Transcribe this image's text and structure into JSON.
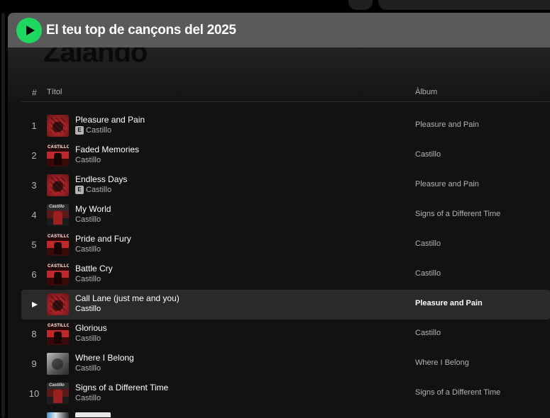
{
  "header": {
    "title": "El teu top de cançons del 2025",
    "background_title": "Zalando"
  },
  "colors": {
    "accent": "#1ed760",
    "sticky_header": "#5a5a5a",
    "panel_bg": "#121212",
    "active_row": "#2a2a2a"
  },
  "columns": {
    "number": "#",
    "title": "Títol",
    "album": "Àlbum"
  },
  "tracks": [
    {
      "num": "1",
      "title": "Pleasure and Pain",
      "explicit": true,
      "artist": "Castillo",
      "album": "Pleasure and Pain",
      "cover": "red"
    },
    {
      "num": "2",
      "title": "Faded Memories",
      "explicit": false,
      "artist": "Castillo",
      "album": "Castillo",
      "cover": "castillo",
      "cover_text": "CASTILLO"
    },
    {
      "num": "3",
      "title": "Endless Days",
      "explicit": true,
      "artist": "Castillo",
      "album": "Pleasure and Pain",
      "cover": "red"
    },
    {
      "num": "4",
      "title": "My World",
      "explicit": false,
      "artist": "Castillo",
      "album": "Signs of a Different Time",
      "cover": "signs",
      "cover_text": "Castillo"
    },
    {
      "num": "5",
      "title": "Pride and Fury",
      "explicit": false,
      "artist": "Castillo",
      "album": "Castillo",
      "cover": "castillo",
      "cover_text": "CASTILLO"
    },
    {
      "num": "6",
      "title": "Battle Cry",
      "explicit": false,
      "artist": "Castillo",
      "album": "Castillo",
      "cover": "castillo",
      "cover_text": "CASTILLO"
    },
    {
      "num": "7",
      "title": "Call Lane (just me and you)",
      "explicit": false,
      "artist": "Castillo",
      "album": "Pleasure and Pain",
      "cover": "red",
      "active": true
    },
    {
      "num": "8",
      "title": "Glorious",
      "explicit": false,
      "artist": "Castillo",
      "album": "Castillo",
      "cover": "castillo",
      "cover_text": "CASTILLO"
    },
    {
      "num": "9",
      "title": "Where I Belong",
      "explicit": false,
      "artist": "Castillo",
      "album": "Where I Belong",
      "cover": "gray"
    },
    {
      "num": "10",
      "title": "Signs of a Different Time",
      "explicit": false,
      "artist": "Castillo",
      "album": "Signs of a Different Time",
      "cover": "signs",
      "cover_text": "Castillo"
    }
  ],
  "explicit_badge": "E",
  "icons": {
    "play": "play-icon",
    "grid": "grid-icon",
    "search": "search-icon"
  }
}
